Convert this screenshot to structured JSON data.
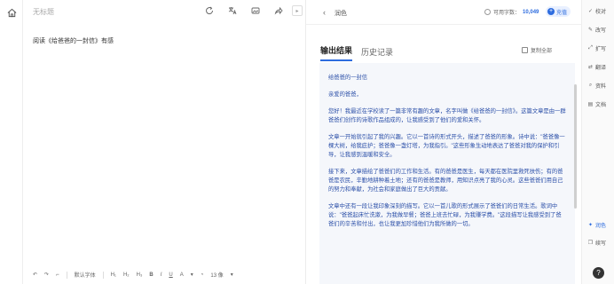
{
  "editor": {
    "title_placeholder": "无标题",
    "body_text": "阅读《给爸爸的一封信》有感"
  },
  "format_bar": {
    "font_label": "默认字体",
    "h1": "H₁",
    "h2": "H₂",
    "h3": "H₃",
    "bold": "B",
    "italic": "I",
    "underline": "U",
    "color": "A",
    "size_label": "13 像"
  },
  "panel": {
    "title": "润色",
    "quota_label": "可用字数：",
    "quota_value": "10,049",
    "recharge_label": "充值",
    "tabs": [
      "输出结果",
      "历史记录"
    ],
    "copy_all_label": "复制全部",
    "result_paragraphs": [
      "给爸爸的一封信",
      "亲爱的爸爸，",
      "您好！我最近在学校读了一篇非常有趣的文章，名字叫做《给爸爸的一封信》。这篇文章是由一群爸爸们创作的诗歌作品组成的，让我感受到了他们的爱和关怀。",
      "文章一开始就引起了我的兴趣。它以一首诗的形式开头，描述了爸爸的形象。诗中说：\"爸爸像一棵大树，给我庇护；爸爸像一盏灯塔，为我指引。\"这些形象生动地表达了爸爸对我的保护和引导，让我感到温暖和安全。",
      "接下来，文章描绘了爸爸们的工作和生活。有的爸爸是医生，每天都在医院里救死扶伤；有的爸爸是农民，辛勤地耕种着土地；还有的爸爸是教师，用知识点亮了我的心灵。这些爸爸们用自己的努力和奉献，为社会和家庭做出了巨大的贡献。",
      "文章中还有一段让我印象深刻的描写。它以一首儿歌的形式展示了爸爸们的日常生活。歌词中说：\"爸爸起床忙洗漱，为我做早餐；爸爸上班去忙碌，为我赚学费。\"这段描写让我感受到了爸爸们的辛苦和付出，也让我更加珍惜他们为我所做的一切。"
    ]
  },
  "rail": {
    "items": [
      "校对",
      "改写",
      "扩写",
      "翻译",
      "资料",
      "文档"
    ],
    "bottom_items": [
      "润色",
      "续写"
    ],
    "help": "?"
  },
  "colors": {
    "accent": "#2d6cdf",
    "result_text": "#2b4fa8",
    "result_bg": "#f5f7fb"
  }
}
